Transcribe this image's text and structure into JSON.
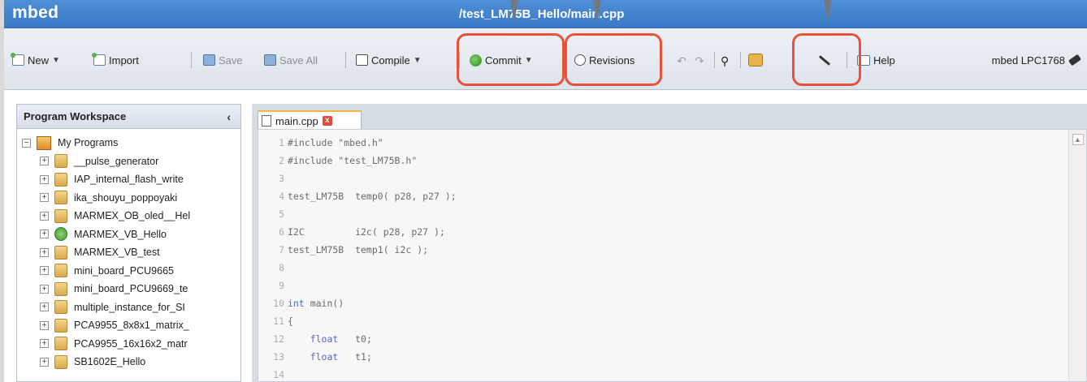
{
  "app": {
    "name": "mbed",
    "document_title": "/test_LM75B_Hello/main.cpp"
  },
  "toolbar": {
    "new_label": "New",
    "import_label": "Import",
    "save_label": "Save",
    "save_all_label": "Save All",
    "compile_label": "Compile",
    "commit_label": "Commit",
    "revisions_label": "Revisions",
    "help_label": "Help",
    "device_label": "mbed LPC1768"
  },
  "sidebar": {
    "title": "Program Workspace",
    "root_label": "My Programs",
    "items": [
      {
        "label": "__pulse_generator",
        "icon": "program-icon"
      },
      {
        "label": "IAP_internal_flash_write",
        "icon": "program-icon"
      },
      {
        "label": "ika_shouyu_poppoyaki",
        "icon": "program-icon"
      },
      {
        "label": "MARMEX_OB_oled__Hel",
        "icon": "program-icon"
      },
      {
        "label": "MARMEX_VB_Hello",
        "icon": "library-icon"
      },
      {
        "label": "MARMEX_VB_test",
        "icon": "program-icon"
      },
      {
        "label": "mini_board_PCU9665",
        "icon": "program-icon"
      },
      {
        "label": "mini_board_PCU9669_te",
        "icon": "program-icon"
      },
      {
        "label": "multiple_instance_for_SI",
        "icon": "program-icon"
      },
      {
        "label": "PCA9955_8x8x1_matrix_",
        "icon": "program-icon"
      },
      {
        "label": "PCA9955_16x16x2_matr",
        "icon": "program-icon"
      },
      {
        "label": "SB1602E_Hello",
        "icon": "program-icon"
      }
    ]
  },
  "editor": {
    "tab_label": "main.cpp",
    "lines": [
      {
        "n": "1",
        "text": "#include \"mbed.h\"",
        "kind": "pp"
      },
      {
        "n": "2",
        "text": "#include \"test_LM75B.h\"",
        "kind": "pp"
      },
      {
        "n": "3",
        "text": "",
        "kind": "plain"
      },
      {
        "n": "4",
        "text": "test_LM75B  temp0( p28, p27 );",
        "kind": "plain"
      },
      {
        "n": "5",
        "text": "",
        "kind": "plain"
      },
      {
        "n": "6",
        "text": "I2C         i2c( p28, p27 );",
        "kind": "plain"
      },
      {
        "n": "7",
        "text": "test_LM75B  temp1( i2c );",
        "kind": "plain"
      },
      {
        "n": "8",
        "text": "",
        "kind": "plain"
      },
      {
        "n": "9",
        "text": "",
        "kind": "plain"
      },
      {
        "n": "10",
        "text": "int main()",
        "kind": "kw-int"
      },
      {
        "n": "11",
        "text": "{",
        "kind": "plain"
      },
      {
        "n": "12",
        "text": "    float   t0;",
        "kind": "kw-float"
      },
      {
        "n": "13",
        "text": "    float   t1;",
        "kind": "kw-float"
      },
      {
        "n": "14",
        "text": "",
        "kind": "plain"
      }
    ]
  },
  "colors": {
    "title_bar": "#3a78c6",
    "highlight": "#e8523b",
    "pointer": "#6f7a84"
  }
}
